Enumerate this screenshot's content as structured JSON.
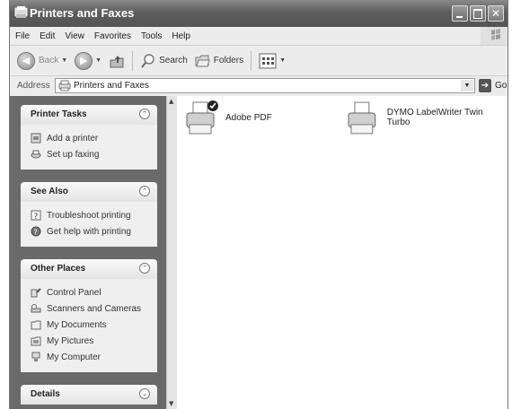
{
  "window": {
    "title": "Printers and Faxes"
  },
  "menu": [
    "File",
    "Edit",
    "View",
    "Favorites",
    "Tools",
    "Help"
  ],
  "toolbar": {
    "back": "Back",
    "search": "Search",
    "folders": "Folders"
  },
  "address": {
    "label": "Address",
    "value": "Printers and Faxes",
    "go": "Go"
  },
  "panels": {
    "printer_tasks": {
      "title": "Printer Tasks",
      "items": [
        "Add a printer",
        "Set up faxing"
      ]
    },
    "see_also": {
      "title": "See Also",
      "items": [
        "Troubleshoot printing",
        "Get help with printing"
      ]
    },
    "other_places": {
      "title": "Other Places",
      "items": [
        "Control Panel",
        "Scanners and Cameras",
        "My Documents",
        "My Pictures",
        "My Computer"
      ]
    },
    "details": {
      "title": "Details"
    }
  },
  "printers": [
    {
      "name": "Adobe PDF",
      "default": true
    },
    {
      "name": "DYMO LabelWriter Twin Turbo",
      "default": false
    }
  ]
}
